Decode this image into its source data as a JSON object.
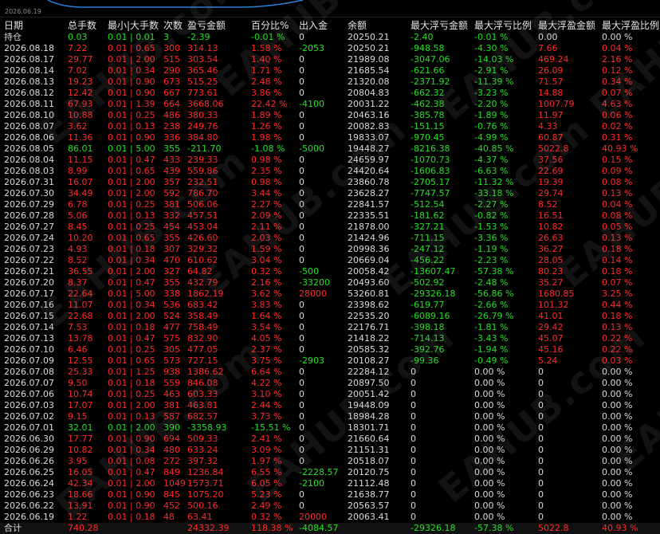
{
  "top_date": "2026.06.19",
  "watermark": "EAHUB.com",
  "headers": [
    "日期",
    "总手数",
    "最小|大手数",
    "次数",
    "盈亏金额",
    "百分比%",
    "出入金",
    "余额",
    "最大浮亏金额",
    "最大浮亏比例",
    "最大浮盈金额",
    "最大浮盈比例"
  ],
  "rows": [
    {
      "c": [
        "持仓",
        "0.03",
        "0.01 | 0.01",
        "3",
        "-2.39",
        "-0.01 %",
        "0",
        "20250.21",
        "-2.40",
        "-0.01 %",
        "0.00",
        "0.00 %"
      ],
      "k": [
        "w",
        "g",
        "g",
        "g",
        "g",
        "g",
        "w",
        "w",
        "g",
        "g",
        "w",
        "w"
      ]
    },
    {
      "c": [
        "2026.08.18",
        "7.22",
        "0.01 | 0.65",
        "300",
        "314.13",
        "1.58 %",
        "-2053",
        "20250.21",
        "-948.58",
        "-4.30 %",
        "7.66",
        "0.04 %"
      ],
      "k": [
        "w",
        "r",
        "r",
        "r",
        "r",
        "r",
        "g",
        "w",
        "g",
        "g",
        "r",
        "r"
      ]
    },
    {
      "c": [
        "2026.08.17",
        "29.77",
        "0.01 | 2.00",
        "515",
        "303.54",
        "1.40 %",
        "0",
        "21989.08",
        "-3047.06",
        "-14.03 %",
        "469.24",
        "2.16 %"
      ],
      "k": [
        "w",
        "r",
        "r",
        "r",
        "r",
        "r",
        "w",
        "w",
        "g",
        "g",
        "r",
        "r"
      ]
    },
    {
      "c": [
        "2026.08.14",
        "7.02",
        "0.01 | 0.34",
        "290",
        "365.46",
        "1.71 %",
        "0",
        "21685.54",
        "-621.66",
        "-2.91 %",
        "26.09",
        "0.12 %"
      ],
      "k": [
        "w",
        "r",
        "r",
        "r",
        "r",
        "r",
        "w",
        "w",
        "g",
        "g",
        "r",
        "r"
      ]
    },
    {
      "c": [
        "2026.08.13",
        "19.23",
        "0.01 | 0.90",
        "673",
        "515.25",
        "2.48 %",
        "0",
        "21320.08",
        "-2371.92",
        "-11.39 %",
        "71.57",
        "0.34 %"
      ],
      "k": [
        "w",
        "r",
        "r",
        "r",
        "r",
        "r",
        "w",
        "w",
        "g",
        "g",
        "r",
        "r"
      ]
    },
    {
      "c": [
        "2026.08.12",
        "12.42",
        "0.01 | 0.90",
        "667",
        "773.61",
        "3.86 %",
        "0",
        "20804.83",
        "-662.32",
        "-3.23 %",
        "14.88",
        "0.07 %"
      ],
      "k": [
        "w",
        "r",
        "r",
        "r",
        "r",
        "r",
        "w",
        "w",
        "g",
        "g",
        "r",
        "r"
      ]
    },
    {
      "c": [
        "2026.08.11",
        "67.93",
        "0.01 | 1.39",
        "664",
        "3668.06",
        "22.42 %",
        "-4100",
        "20031.22",
        "-462.38",
        "-2.20 %",
        "1007.79",
        "4.63 %"
      ],
      "k": [
        "w",
        "r",
        "r",
        "r",
        "r",
        "r",
        "g",
        "w",
        "g",
        "g",
        "r",
        "r"
      ]
    },
    {
      "c": [
        "2026.08.10",
        "10.88",
        "0.01 | 0.25",
        "486",
        "380.33",
        "1.89 %",
        "0",
        "20463.16",
        "-385.78",
        "-1.89 %",
        "11.97",
        "0.06 %"
      ],
      "k": [
        "w",
        "r",
        "r",
        "r",
        "r",
        "r",
        "w",
        "w",
        "g",
        "g",
        "r",
        "r"
      ]
    },
    {
      "c": [
        "2026.08.07",
        "3.62",
        "0.01 | 0.13",
        "238",
        "249.76",
        "1.26 %",
        "0",
        "20082.83",
        "-151.15",
        "-0.76 %",
        "4.33",
        "0.02 %"
      ],
      "k": [
        "w",
        "r",
        "r",
        "r",
        "r",
        "r",
        "w",
        "w",
        "g",
        "g",
        "r",
        "r"
      ]
    },
    {
      "c": [
        "2026.08.06",
        "11.36",
        "0.01 | 0.90",
        "336",
        "384.80",
        "1.98 %",
        "0",
        "19833.07",
        "-970.45",
        "-4.99 %",
        "60.87",
        "0.31 %"
      ],
      "k": [
        "w",
        "r",
        "r",
        "r",
        "r",
        "r",
        "w",
        "w",
        "g",
        "g",
        "r",
        "r"
      ]
    },
    {
      "c": [
        "2026.08.05",
        "86.01",
        "0.01 | 5.00",
        "355",
        "-211.70",
        "-1.08 %",
        "-5000",
        "19448.27",
        "-8216.38",
        "-40.85 %",
        "5022.8",
        "40.93 %"
      ],
      "k": [
        "w",
        "g",
        "g",
        "g",
        "g",
        "g",
        "g",
        "w",
        "g",
        "g",
        "r",
        "r"
      ]
    },
    {
      "c": [
        "2026.08.04",
        "11.15",
        "0.01 | 0.47",
        "433",
        "239.33",
        "0.98 %",
        "0",
        "24659.97",
        "-1070.73",
        "-4.37 %",
        "37.56",
        "0.15 %"
      ],
      "k": [
        "w",
        "r",
        "r",
        "r",
        "r",
        "r",
        "w",
        "w",
        "g",
        "g",
        "r",
        "r"
      ]
    },
    {
      "c": [
        "2026.08.03",
        "8.99",
        "0.01 | 0.65",
        "439",
        "559.86",
        "2.35 %",
        "0",
        "24420.64",
        "-1606.83",
        "-6.63 %",
        "22.69",
        "0.09 %"
      ],
      "k": [
        "w",
        "r",
        "r",
        "r",
        "r",
        "r",
        "w",
        "w",
        "g",
        "g",
        "r",
        "r"
      ]
    },
    {
      "c": [
        "2026.07.31",
        "16.07",
        "0.01 | 2.00",
        "357",
        "232.51",
        "0.98 %",
        "0",
        "23860.78",
        "-2705.17",
        "-11.32 %",
        "19.39",
        "0.08 %"
      ],
      "k": [
        "w",
        "r",
        "r",
        "r",
        "r",
        "r",
        "w",
        "w",
        "g",
        "g",
        "r",
        "r"
      ]
    },
    {
      "c": [
        "2026.07.30",
        "34.49",
        "0.01 | 2.00",
        "592",
        "786.70",
        "3.44 %",
        "0",
        "23628.27",
        "-7747.57",
        "-33.18 %",
        "29.74",
        "0.13 %"
      ],
      "k": [
        "w",
        "r",
        "r",
        "r",
        "r",
        "r",
        "w",
        "w",
        "g",
        "g",
        "r",
        "r"
      ]
    },
    {
      "c": [
        "2026.07.29",
        "6.78",
        "0.01 | 0.25",
        "381",
        "506.06",
        "2.27 %",
        "0",
        "22841.57",
        "-512.54",
        "-2.27 %",
        "8.52",
        "0.04 %"
      ],
      "k": [
        "w",
        "r",
        "r",
        "r",
        "r",
        "r",
        "w",
        "w",
        "g",
        "g",
        "r",
        "r"
      ]
    },
    {
      "c": [
        "2026.07.28",
        "5.06",
        "0.01 | 0.13",
        "332",
        "457.51",
        "2.09 %",
        "0",
        "22335.51",
        "-181.62",
        "-0.82 %",
        "16.51",
        "0.08 %"
      ],
      "k": [
        "w",
        "r",
        "r",
        "r",
        "r",
        "r",
        "w",
        "w",
        "g",
        "g",
        "r",
        "r"
      ]
    },
    {
      "c": [
        "2026.07.27",
        "8.45",
        "0.01 | 0.25",
        "454",
        "453.04",
        "2.11 %",
        "0",
        "21878.00",
        "-327.21",
        "-1.53 %",
        "10.82",
        "0.05 %"
      ],
      "k": [
        "w",
        "r",
        "r",
        "r",
        "r",
        "r",
        "w",
        "w",
        "g",
        "g",
        "r",
        "r"
      ]
    },
    {
      "c": [
        "2026.07.24",
        "10.20",
        "0.01 | 0.65",
        "355",
        "426.60",
        "2.03 %",
        "0",
        "21424.96",
        "-711.15",
        "-3.36 %",
        "26.63",
        "0.13 %"
      ],
      "k": [
        "w",
        "r",
        "r",
        "r",
        "r",
        "r",
        "w",
        "w",
        "g",
        "g",
        "r",
        "r"
      ]
    },
    {
      "c": [
        "2026.07.23",
        "4.93",
        "0.01 | 0.18",
        "307",
        "329.32",
        "1.59 %",
        "0",
        "20998.36",
        "-247.12",
        "-1.19 %",
        "36.27",
        "0.18 %"
      ],
      "k": [
        "w",
        "r",
        "r",
        "r",
        "r",
        "r",
        "w",
        "w",
        "g",
        "g",
        "r",
        "r"
      ]
    },
    {
      "c": [
        "2026.07.22",
        "8.52",
        "0.01 | 0.34",
        "470",
        "610.62",
        "3.04 %",
        "0",
        "20669.04",
        "-456.22",
        "-2.23 %",
        "28.05",
        "0.14 %"
      ],
      "k": [
        "w",
        "r",
        "r",
        "r",
        "r",
        "r",
        "w",
        "w",
        "g",
        "g",
        "r",
        "r"
      ]
    },
    {
      "c": [
        "2026.07.21",
        "36.55",
        "0.01 | 2.00",
        "327",
        "64.82",
        "0.32 %",
        "-500",
        "20058.42",
        "-13607.47",
        "-57.38 %",
        "80.23",
        "0.18 %"
      ],
      "k": [
        "w",
        "r",
        "r",
        "r",
        "r",
        "r",
        "g",
        "w",
        "g",
        "g",
        "r",
        "r"
      ]
    },
    {
      "c": [
        "2026.07.20",
        "8.37",
        "0.01 | 0.47",
        "355",
        "432.79",
        "2.16 %",
        "-33200",
        "20493.60",
        "-502.92",
        "-2.48 %",
        "35.27",
        "0.07 %"
      ],
      "k": [
        "w",
        "r",
        "r",
        "r",
        "r",
        "r",
        "g",
        "w",
        "g",
        "g",
        "r",
        "r"
      ]
    },
    {
      "c": [
        "2026.07.17",
        "22.64",
        "0.01 | 5.00",
        "338",
        "1862.19",
        "3.62 %",
        "28000",
        "53260.81",
        "-29326.18",
        "-56.86 %",
        "1680.85",
        "3.25 %"
      ],
      "k": [
        "w",
        "r",
        "r",
        "r",
        "r",
        "r",
        "r",
        "w",
        "g",
        "g",
        "r",
        "r"
      ]
    },
    {
      "c": [
        "2026.07.16",
        "11.07",
        "0.01 | 0.34",
        "536",
        "683.42",
        "3.83 %",
        "0",
        "23398.62",
        "-619.77",
        "-2.66 %",
        "101.32",
        "0.44 %"
      ],
      "k": [
        "w",
        "r",
        "r",
        "r",
        "r",
        "r",
        "w",
        "w",
        "g",
        "g",
        "r",
        "r"
      ]
    },
    {
      "c": [
        "2026.07.15",
        "22.68",
        "0.01 | 2.00",
        "524",
        "358.49",
        "1.64 %",
        "0",
        "22535.20",
        "-6089.16",
        "-26.79 %",
        "41.01",
        "0.18 %"
      ],
      "k": [
        "w",
        "r",
        "r",
        "r",
        "r",
        "r",
        "w",
        "w",
        "g",
        "g",
        "r",
        "r"
      ]
    },
    {
      "c": [
        "2026.07.14",
        "7.53",
        "0.01 | 0.18",
        "477",
        "758.49",
        "3.54 %",
        "0",
        "22176.71",
        "-398.18",
        "-1.81 %",
        "29.42",
        "0.13 %"
      ],
      "k": [
        "w",
        "r",
        "r",
        "r",
        "r",
        "r",
        "w",
        "w",
        "g",
        "g",
        "r",
        "r"
      ]
    },
    {
      "c": [
        "2026.07.13",
        "13.78",
        "0.01 | 0.47",
        "575",
        "832.90",
        "4.05 %",
        "0",
        "21418.22",
        "-714.13",
        "-3.43 %",
        "45.07",
        "0.22 %"
      ],
      "k": [
        "w",
        "r",
        "r",
        "r",
        "r",
        "r",
        "w",
        "w",
        "g",
        "g",
        "r",
        "r"
      ]
    },
    {
      "c": [
        "2026.07.10",
        "6.46",
        "0.01 | 0.25",
        "305",
        "477.05",
        "2.37 %",
        "0",
        "20585.32",
        "-392.76",
        "-1.94 %",
        "45.16",
        "0.22 %"
      ],
      "k": [
        "w",
        "r",
        "r",
        "r",
        "r",
        "r",
        "w",
        "w",
        "g",
        "g",
        "r",
        "r"
      ]
    },
    {
      "c": [
        "2026.07.09",
        "12.55",
        "0.01 | 0.65",
        "573",
        "727.15",
        "3.75 %",
        "-2903",
        "20108.27",
        "-99.36",
        "-0.49 %",
        "5.24",
        "0.03 %"
      ],
      "k": [
        "w",
        "r",
        "r",
        "r",
        "r",
        "r",
        "g",
        "w",
        "g",
        "g",
        "r",
        "r"
      ]
    },
    {
      "c": [
        "2026.07.08",
        "25.33",
        "0.01 | 1.25",
        "938",
        "1386.62",
        "6.64 %",
        "0",
        "22284.12",
        "0",
        "0.00 %",
        "0",
        "0.00 %"
      ],
      "k": [
        "w",
        "r",
        "r",
        "r",
        "r",
        "r",
        "w",
        "w",
        "w",
        "w",
        "w",
        "w"
      ]
    },
    {
      "c": [
        "2026.07.07",
        "9.50",
        "0.01 | 0.18",
        "559",
        "846.08",
        "4.22 %",
        "0",
        "20897.50",
        "0",
        "0.00 %",
        "0",
        "0.00 %"
      ],
      "k": [
        "w",
        "r",
        "r",
        "r",
        "r",
        "r",
        "w",
        "w",
        "w",
        "w",
        "w",
        "w"
      ]
    },
    {
      "c": [
        "2026.07.06",
        "10.74",
        "0.01 | 0.25",
        "463",
        "603.33",
        "3.10 %",
        "0",
        "20051.42",
        "0",
        "0.00 %",
        "0",
        "0.00 %"
      ],
      "k": [
        "w",
        "r",
        "r",
        "r",
        "r",
        "r",
        "w",
        "w",
        "w",
        "w",
        "w",
        "w"
      ]
    },
    {
      "c": [
        "2026.07.03",
        "17.07",
        "0.01 | 2.00",
        "381",
        "463.81",
        "2.44 %",
        "0",
        "19448.09",
        "0",
        "0.00 %",
        "0",
        "0.00 %"
      ],
      "k": [
        "w",
        "r",
        "r",
        "r",
        "r",
        "r",
        "w",
        "w",
        "w",
        "w",
        "w",
        "w"
      ]
    },
    {
      "c": [
        "2026.07.02",
        "9.15",
        "0.01 | 0.13",
        "587",
        "682.57",
        "3.73 %",
        "0",
        "18984.28",
        "0",
        "0.00 %",
        "0",
        "0.00 %"
      ],
      "k": [
        "w",
        "r",
        "r",
        "r",
        "r",
        "r",
        "w",
        "w",
        "w",
        "w",
        "w",
        "w"
      ]
    },
    {
      "c": [
        "2026.07.01",
        "32.01",
        "0.01 | 2.00",
        "390",
        "-3358.93",
        "-15.51 %",
        "0",
        "18301.71",
        "0",
        "0.00 %",
        "0",
        "0.00 %"
      ],
      "k": [
        "w",
        "g",
        "g",
        "g",
        "g",
        "g",
        "w",
        "w",
        "w",
        "w",
        "w",
        "w"
      ]
    },
    {
      "c": [
        "2026.06.30",
        "17.77",
        "0.01 | 0.90",
        "694",
        "509.33",
        "2.41 %",
        "0",
        "21660.64",
        "0",
        "0.00 %",
        "0",
        "0.00 %"
      ],
      "k": [
        "w",
        "r",
        "r",
        "r",
        "r",
        "r",
        "w",
        "w",
        "w",
        "w",
        "w",
        "w"
      ]
    },
    {
      "c": [
        "2026.06.29",
        "10.82",
        "0.01 | 0.34",
        "480",
        "633.24",
        "3.09 %",
        "0",
        "21151.31",
        "0",
        "0.00 %",
        "0",
        "0.00 %"
      ],
      "k": [
        "w",
        "r",
        "r",
        "r",
        "r",
        "r",
        "w",
        "w",
        "w",
        "w",
        "w",
        "w"
      ]
    },
    {
      "c": [
        "2026.06.26",
        "3.95",
        "0.01 | 0.08",
        "272",
        "397.32",
        "1.97 %",
        "0",
        "20518.07",
        "0",
        "0.00 %",
        "0",
        "0.00 %"
      ],
      "k": [
        "w",
        "r",
        "r",
        "r",
        "r",
        "r",
        "w",
        "w",
        "w",
        "w",
        "w",
        "w"
      ]
    },
    {
      "c": [
        "2026.06.25",
        "16.05",
        "0.01 | 0.47",
        "849",
        "1236.84",
        "6.55 %",
        "-2228.57",
        "20120.75",
        "0",
        "0.00 %",
        "0",
        "0.00 %"
      ],
      "k": [
        "w",
        "r",
        "r",
        "r",
        "r",
        "r",
        "g",
        "w",
        "w",
        "w",
        "w",
        "w"
      ]
    },
    {
      "c": [
        "2026.06.24",
        "42.34",
        "0.01 | 2.00",
        "1049",
        "1573.71",
        "6.05 %",
        "-2100",
        "21112.48",
        "0",
        "0.00 %",
        "0",
        "0.00 %"
      ],
      "k": [
        "w",
        "r",
        "r",
        "r",
        "r",
        "r",
        "g",
        "w",
        "w",
        "w",
        "w",
        "w"
      ]
    },
    {
      "c": [
        "2026.06.23",
        "18.66",
        "0.01 | 0.90",
        "845",
        "1075.20",
        "5.23 %",
        "0",
        "21638.77",
        "0",
        "0.00 %",
        "0",
        "0.00 %"
      ],
      "k": [
        "w",
        "r",
        "r",
        "r",
        "r",
        "r",
        "w",
        "w",
        "w",
        "w",
        "w",
        "w"
      ]
    },
    {
      "c": [
        "2026.06.22",
        "13.91",
        "0.01 | 0.90",
        "452",
        "500.16",
        "2.49 %",
        "0",
        "20563.57",
        "0",
        "0.00 %",
        "0",
        "0.00 %"
      ],
      "k": [
        "w",
        "r",
        "r",
        "r",
        "r",
        "r",
        "w",
        "w",
        "w",
        "w",
        "w",
        "w"
      ]
    },
    {
      "c": [
        "2026.06.19",
        "1.22",
        "0.01 | 0.18",
        "48",
        "63.41",
        "0.32 %",
        "20000",
        "20063.41",
        "0",
        "0.00 %",
        "0",
        "0.00 %"
      ],
      "k": [
        "w",
        "r",
        "r",
        "r",
        "r",
        "r",
        "r",
        "w",
        "w",
        "w",
        "w",
        "w"
      ]
    },
    {
      "c": [
        "合计",
        "740.28",
        "",
        "",
        "24332.39",
        "118.38 %",
        "-4084.57",
        "",
        "-29326.18",
        "-57.38 %",
        "5022.8",
        "40.93 %"
      ],
      "k": [
        "w",
        "r",
        "r",
        "r",
        "r",
        "r",
        "g",
        "w",
        "g",
        "g",
        "r",
        "r"
      ]
    }
  ],
  "colors": {
    "red": "#ff2a2a",
    "green": "#22e022",
    "white": "#dcdcdc",
    "background": "#000000"
  }
}
